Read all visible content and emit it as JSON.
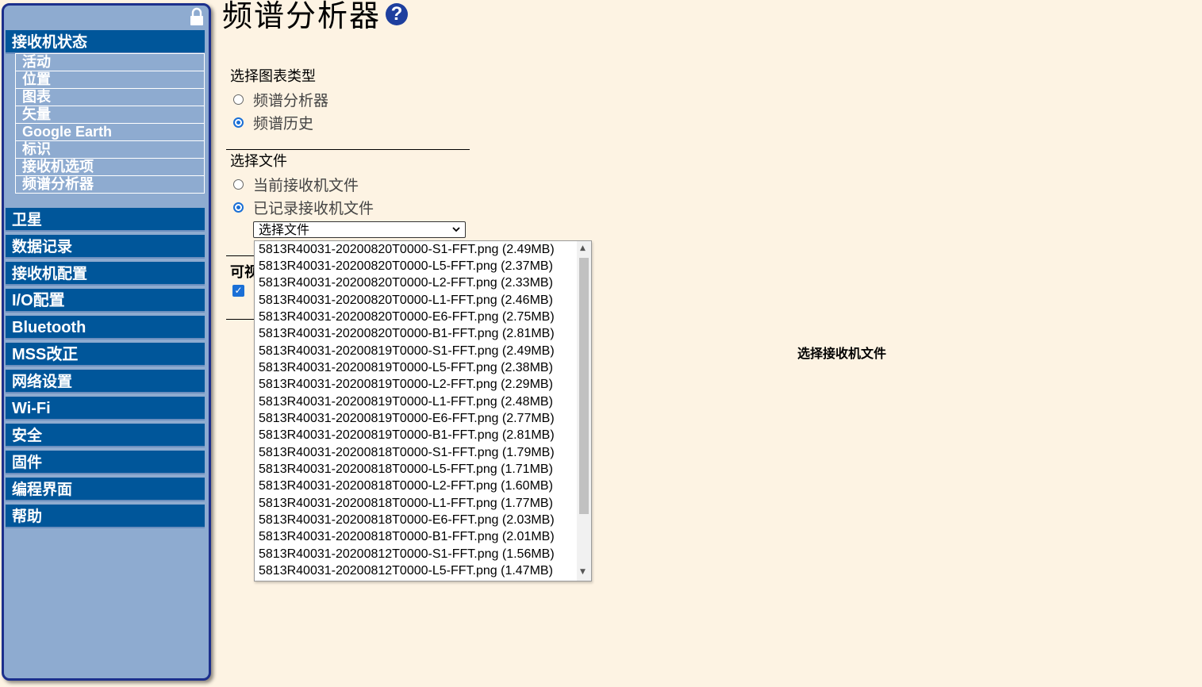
{
  "sidebar": {
    "receiver_status": {
      "title": "接收机状态",
      "items": [
        "活动",
        "位置",
        "图表",
        "矢量",
        "Google Earth",
        "标识",
        "接收机选项",
        "频谱分析器"
      ]
    },
    "menus": [
      "卫星",
      "数据记录",
      "接收机配置",
      "I/O配置",
      "Bluetooth",
      "MSS改正",
      "网络设置",
      "Wi-Fi",
      "安全",
      "固件",
      "编程界面",
      "帮助"
    ]
  },
  "page": {
    "title": "频谱分析器",
    "help_icon": "question-icon"
  },
  "chart_type": {
    "label": "选择图表类型",
    "options": [
      "频谱分析器",
      "频谱历史"
    ],
    "selected": "频谱历史"
  },
  "file_source": {
    "label": "选择文件",
    "options": [
      "当前接收机文件",
      "已记录接收机文件"
    ],
    "selected": "已记录接收机文件"
  },
  "file_select": {
    "value": "选择文件",
    "options": [
      "5813R40031-20200820T0000-S1-FFT.png (2.49MB)",
      "5813R40031-20200820T0000-L5-FFT.png (2.37MB)",
      "5813R40031-20200820T0000-L2-FFT.png (2.33MB)",
      "5813R40031-20200820T0000-L1-FFT.png (2.46MB)",
      "5813R40031-20200820T0000-E6-FFT.png (2.75MB)",
      "5813R40031-20200820T0000-B1-FFT.png (2.81MB)",
      "5813R40031-20200819T0000-S1-FFT.png (2.49MB)",
      "5813R40031-20200819T0000-L5-FFT.png (2.38MB)",
      "5813R40031-20200819T0000-L2-FFT.png (2.29MB)",
      "5813R40031-20200819T0000-L1-FFT.png (2.48MB)",
      "5813R40031-20200819T0000-E6-FFT.png (2.77MB)",
      "5813R40031-20200819T0000-B1-FFT.png (2.81MB)",
      "5813R40031-20200818T0000-S1-FFT.png (1.79MB)",
      "5813R40031-20200818T0000-L5-FFT.png (1.71MB)",
      "5813R40031-20200818T0000-L2-FFT.png (1.60MB)",
      "5813R40031-20200818T0000-L1-FFT.png (1.77MB)",
      "5813R40031-20200818T0000-E6-FFT.png (2.03MB)",
      "5813R40031-20200818T0000-B1-FFT.png (2.01MB)",
      "5813R40031-20200812T0000-S1-FFT.png (1.56MB)",
      "5813R40031-20200812T0000-L5-FFT.png (1.47MB)"
    ]
  },
  "partial_label": "可视",
  "checkbox_checked": true,
  "center_message": "选择接收机文件",
  "colors": {
    "background": "#fdf3e3",
    "sidebar": "#8eabd0",
    "menu_header": "#00569a",
    "sidebar_border": "#1c2f8c",
    "accent": "#1a6fd6"
  }
}
